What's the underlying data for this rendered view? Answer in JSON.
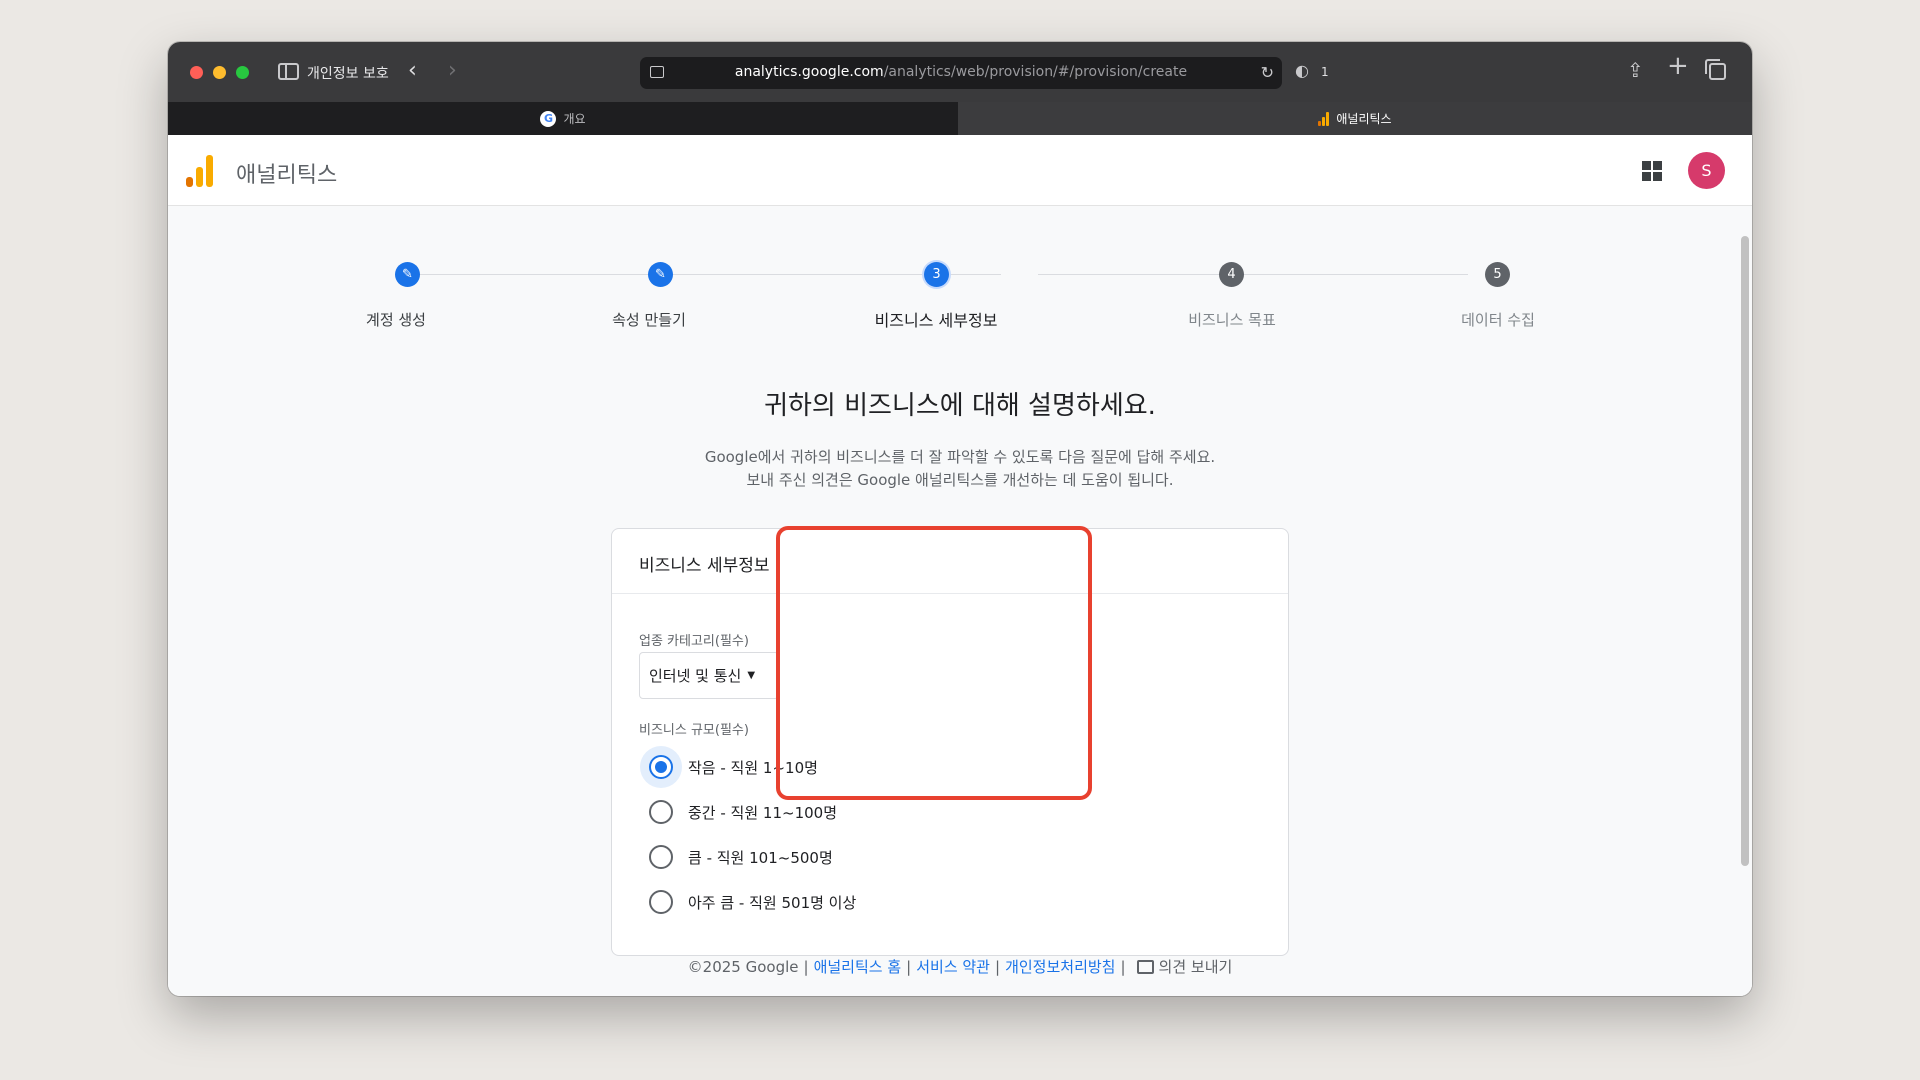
{
  "browser": {
    "profile_label": "개인정보 보호",
    "url_host": "analytics.google.com",
    "url_path": "/analytics/web/provision/#/provision/create",
    "shield_count": "1",
    "tabs": [
      {
        "label": "개요"
      },
      {
        "label": "애널리틱스"
      }
    ],
    "g_letter": "G"
  },
  "app": {
    "title": "애널리틱스",
    "avatar_letter": "S",
    "brand_colors": [
      "#f9ab00",
      "#e37400"
    ]
  },
  "stepper": {
    "steps": [
      {
        "marker": "✎",
        "label": "계정 생성",
        "state": "done"
      },
      {
        "marker": "✎",
        "label": "속성 만들기",
        "state": "done"
      },
      {
        "marker": "3",
        "label": "비즈니스 세부정보",
        "state": "current"
      },
      {
        "marker": "4",
        "label": "비즈니스 목표",
        "state": "todo"
      },
      {
        "marker": "5",
        "label": "데이터 수집",
        "state": "todo"
      }
    ]
  },
  "main": {
    "heading": "귀하의 비즈니스에 대해 설명하세요.",
    "desc_line1": "Google에서 귀하의 비즈니스를 더 잘 파악할 수 있도록 다음 질문에 답해 주세요.",
    "desc_line2": "보내 주신 의견은 Google 애널리틱스를 개선하는 데 도움이 됩니다."
  },
  "card": {
    "title": "비즈니스 세부정보",
    "industry_label": "업종 카테고리(필수)",
    "industry_value": "인터넷 및 통신",
    "size_label": "비즈니스 규모(필수)",
    "size_options": [
      {
        "label": "작음 - 직원 1~10명",
        "checked": true
      },
      {
        "label": "중간 - 직원 11~100명",
        "checked": false
      },
      {
        "label": "큼 - 직원 101~500명",
        "checked": false
      },
      {
        "label": "아주 큼 - 직원 501명 이상",
        "checked": false
      }
    ]
  },
  "footer": {
    "copyright": "©2025 Google",
    "sep": "|",
    "links": [
      "애널리틱스 홈",
      "서비스 약관",
      "개인정보처리방침"
    ],
    "feedback": "의견 보내기"
  },
  "colors": {
    "accent": "#1a73e8",
    "highlight": "#e8412f",
    "avatar": "#d63a6b"
  }
}
